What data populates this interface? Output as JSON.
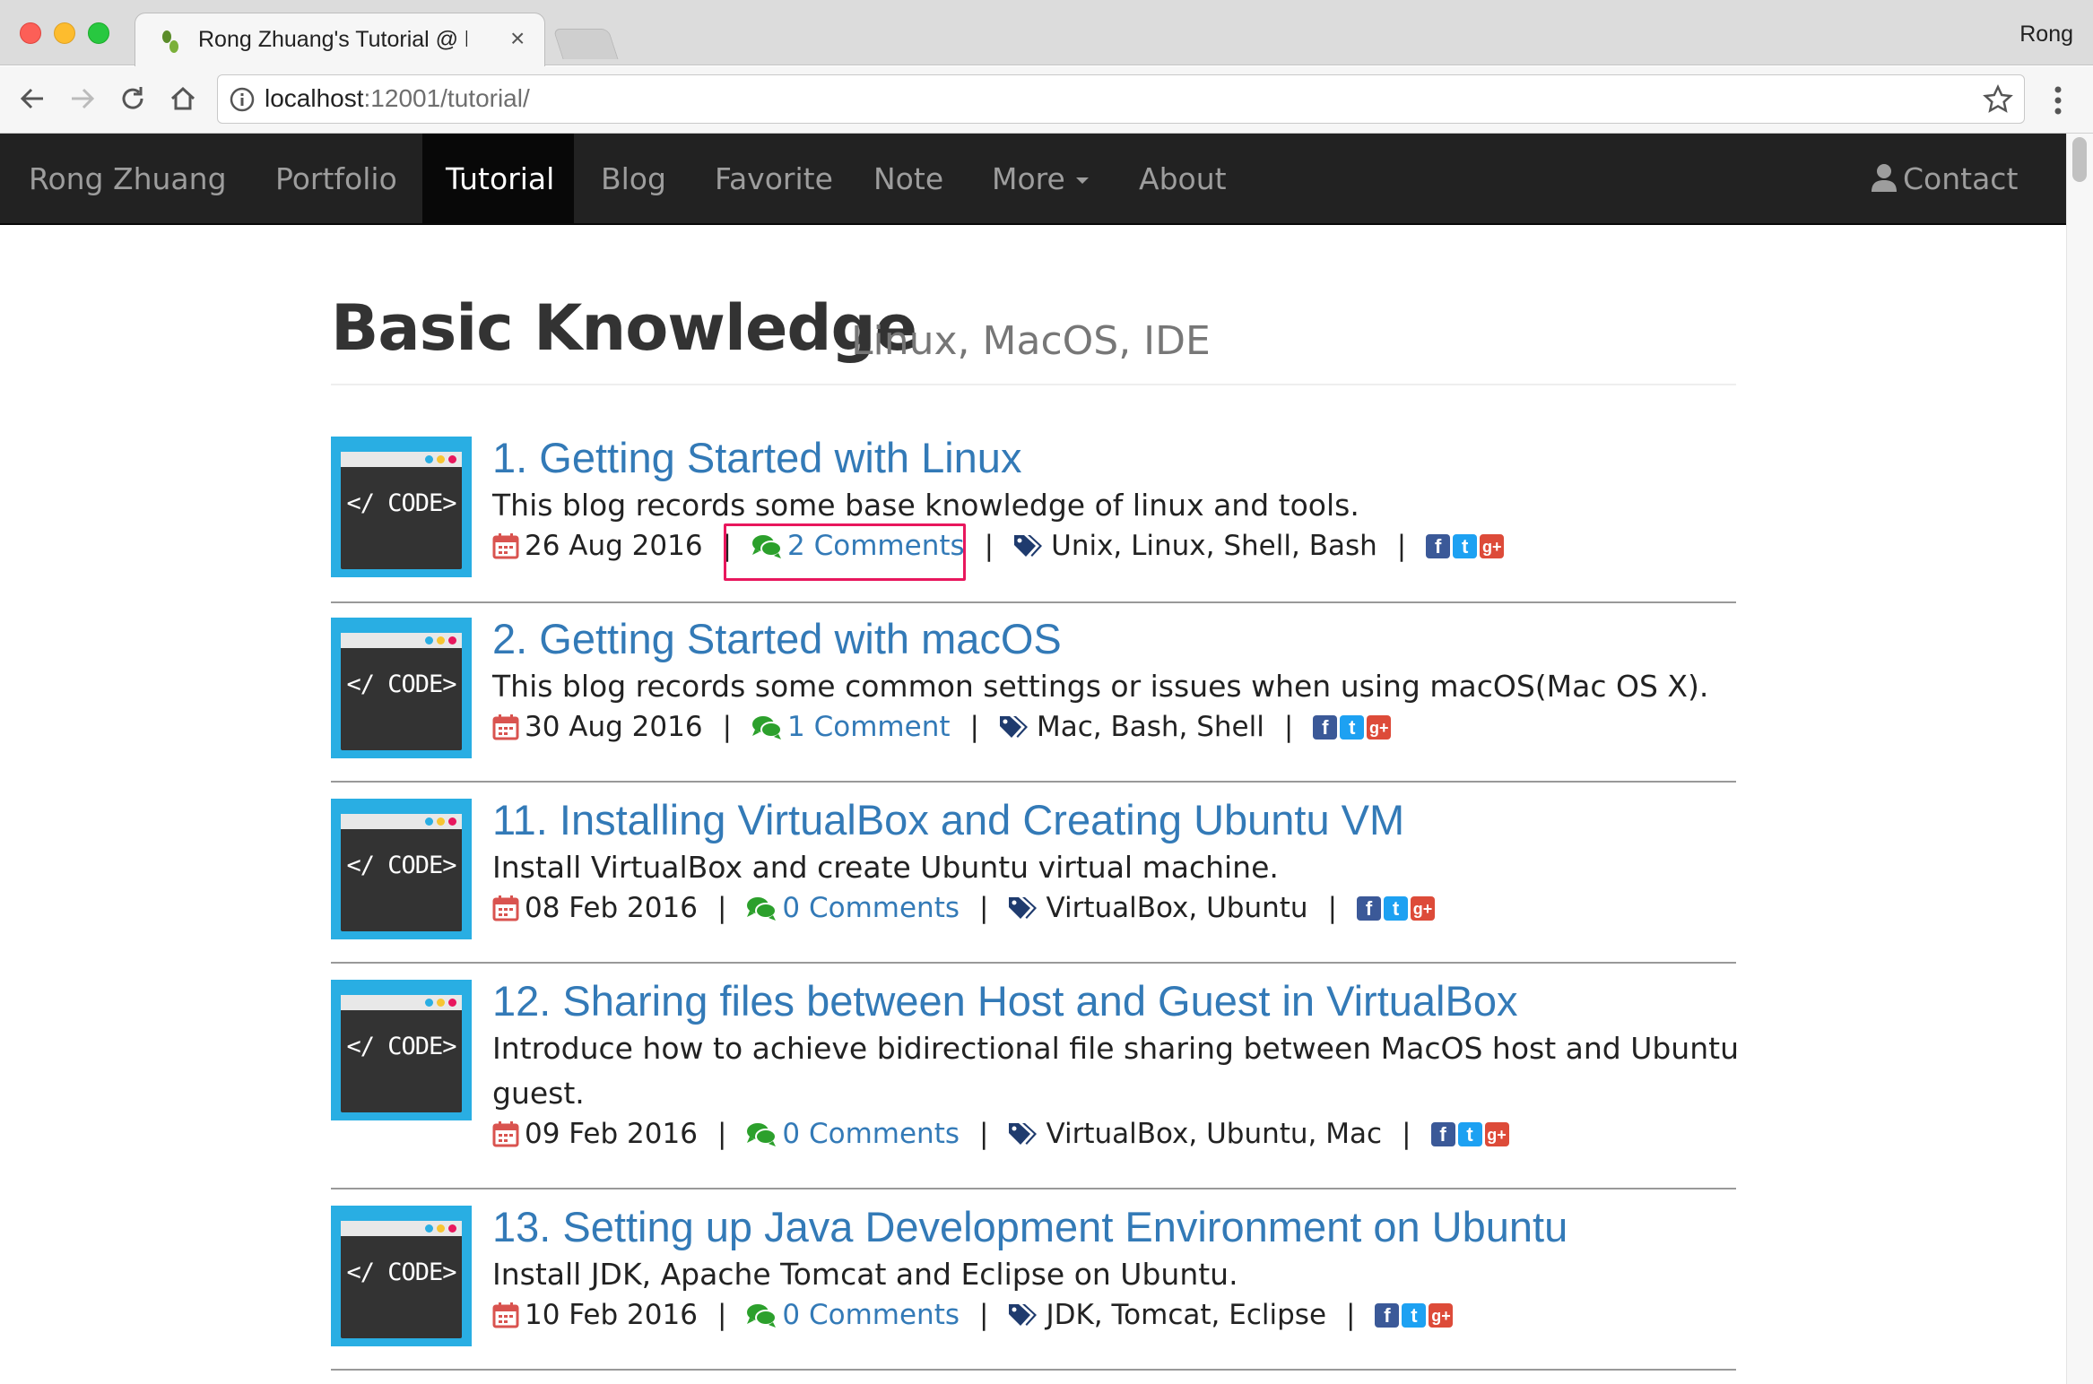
{
  "browser": {
    "tab_title": "Rong Zhuang's Tutorial @ http",
    "tab_close": "×",
    "profile_name": "Rong",
    "url_host": "localhost",
    "url_rest": ":12001/tutorial/"
  },
  "navbar": {
    "brand": "Rong Zhuang",
    "items": [
      "Portfolio",
      "Tutorial",
      "Blog",
      "Favorite",
      "Note",
      "More",
      "About"
    ],
    "active_item": "Tutorial",
    "contact": "Contact"
  },
  "header": {
    "title": "Basic Knowledge",
    "subtitle": "Linux, MacOS, IDE"
  },
  "thumbnail_text": "</ CODE>",
  "separator": "|",
  "social_glyphs": {
    "facebook": "f",
    "twitter": "t",
    "google_plus": "g+"
  },
  "posts": [
    {
      "title": "1. Getting Started with Linux",
      "description": "This blog records some base knowledge of linux and tools.",
      "date": "26 Aug 2016",
      "comments": "2 Comments",
      "tags": "Unix, Linux, Shell, Bash"
    },
    {
      "title": "2. Getting Started with macOS",
      "description": "This blog records some common settings or issues when using macOS(Mac OS X).",
      "date": "30 Aug 2016",
      "comments": "1 Comment",
      "tags": "Mac, Bash, Shell"
    },
    {
      "title": "11. Installing VirtualBox and Creating Ubuntu VM",
      "description": "Install VirtualBox and create Ubuntu virtual machine.",
      "date": "08 Feb 2016",
      "comments": "0 Comments",
      "tags": "VirtualBox, Ubuntu"
    },
    {
      "title": "12. Sharing files between Host and Guest in VirtualBox",
      "description": "Introduce how to achieve bidirectional file sharing between MacOS host and Ubuntu guest.",
      "date": "09 Feb 2016",
      "comments": "0 Comments",
      "tags": "VirtualBox, Ubuntu, Mac"
    },
    {
      "title": "13. Setting up Java Development Environment on Ubuntu",
      "description": "Install JDK, Apache Tomcat and Eclipse on Ubuntu.",
      "date": "10 Feb 2016",
      "comments": "0 Comments",
      "tags": "JDK, Tomcat, Eclipse"
    }
  ],
  "colors": {
    "navbar_bg": "#222222",
    "link": "#337ab7",
    "comment_icon": "#2ca02c",
    "calendar_icon": "#d9534f",
    "highlight_box": "#e8175d",
    "thumbnail_bg": "#29aee3"
  }
}
